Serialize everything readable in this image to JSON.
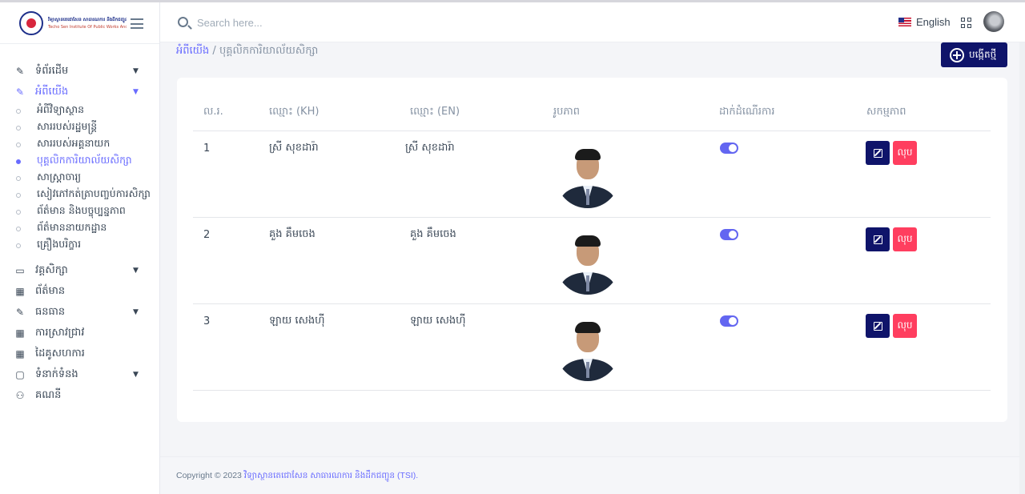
{
  "brand": {
    "line1": "វិទ្យាស្ថានតេជោសែន សាធារណការ និងដឹកជញ្ជូន",
    "line2": "Techo Sen Institute Of Public Works And Transport"
  },
  "topbar": {
    "search_placeholder": "Search here...",
    "language": "English"
  },
  "sidebar": {
    "home": "ទំព័រដើម",
    "about": "អំពីយើង",
    "about_items": [
      "អំពីវិទ្យាស្ថាន",
      "សាររបស់រដ្ឋមន្ត្រី",
      "សាររបស់អគ្គនាយក",
      "បុគ្គលិកការិយាល័យសិក្សា",
      "សាស្ត្រាចារ្យ",
      "សៀវភៅកត់ត្រាបញ្ចប់ការសិក្សា",
      "ព័ត៌មាន និងបច្ចុប្បន្នភាព",
      "ព័ត៌មាននាយកដ្ឋាន",
      "គ្រឿងបរិក្ខារ"
    ],
    "courses": "វគ្គសិក្សា",
    "news": "ព័ត៌មាន",
    "resources": "ធនធាន",
    "research": "ការស្រាវជ្រាវ",
    "partners": "ដៃគូសហការ",
    "contact": "ទំនាក់ទំនង",
    "account": "គណនី"
  },
  "breadcrumb": {
    "parent": "អំពីយើង",
    "sep": "/",
    "current": "បុគ្គលិកការិយាល័យសិក្សា"
  },
  "new_button": "បង្កើតថ្មី",
  "table": {
    "headers": {
      "no": "ល.រ.",
      "name_kh": "ឈ្មោះ (KH)",
      "name_en": "ឈ្មោះ (EN)",
      "photo": "រូបភាព",
      "status": "ដាក់ដំណើរការ",
      "action": "សកម្មភាព"
    },
    "delete_label": "លុប",
    "rows": [
      {
        "no": "1",
        "name_kh": "ស្រី សុខដារ៉ា",
        "name_en": "ស្រី សុខដារ៉ា",
        "enabled": true
      },
      {
        "no": "2",
        "name_kh": "គួង គឹមចេង",
        "name_en": "គួង គឹមចេង",
        "enabled": true
      },
      {
        "no": "3",
        "name_kh": "ឡាយ សេងហ៊ី",
        "name_en": "ឡាយ សេងហ៊ី",
        "enabled": true
      }
    ]
  },
  "footer": {
    "copyright": "Copyright © 2023",
    "org": "វិទ្យាស្ថានតេជោសែន សាធារណការ និងដឹកជញ្ជូន (TSI)."
  },
  "colors": {
    "accent": "#696cff",
    "primary_button": "#0f146a",
    "danger": "#ff3e5f",
    "toggle_on": "#6366f1"
  }
}
